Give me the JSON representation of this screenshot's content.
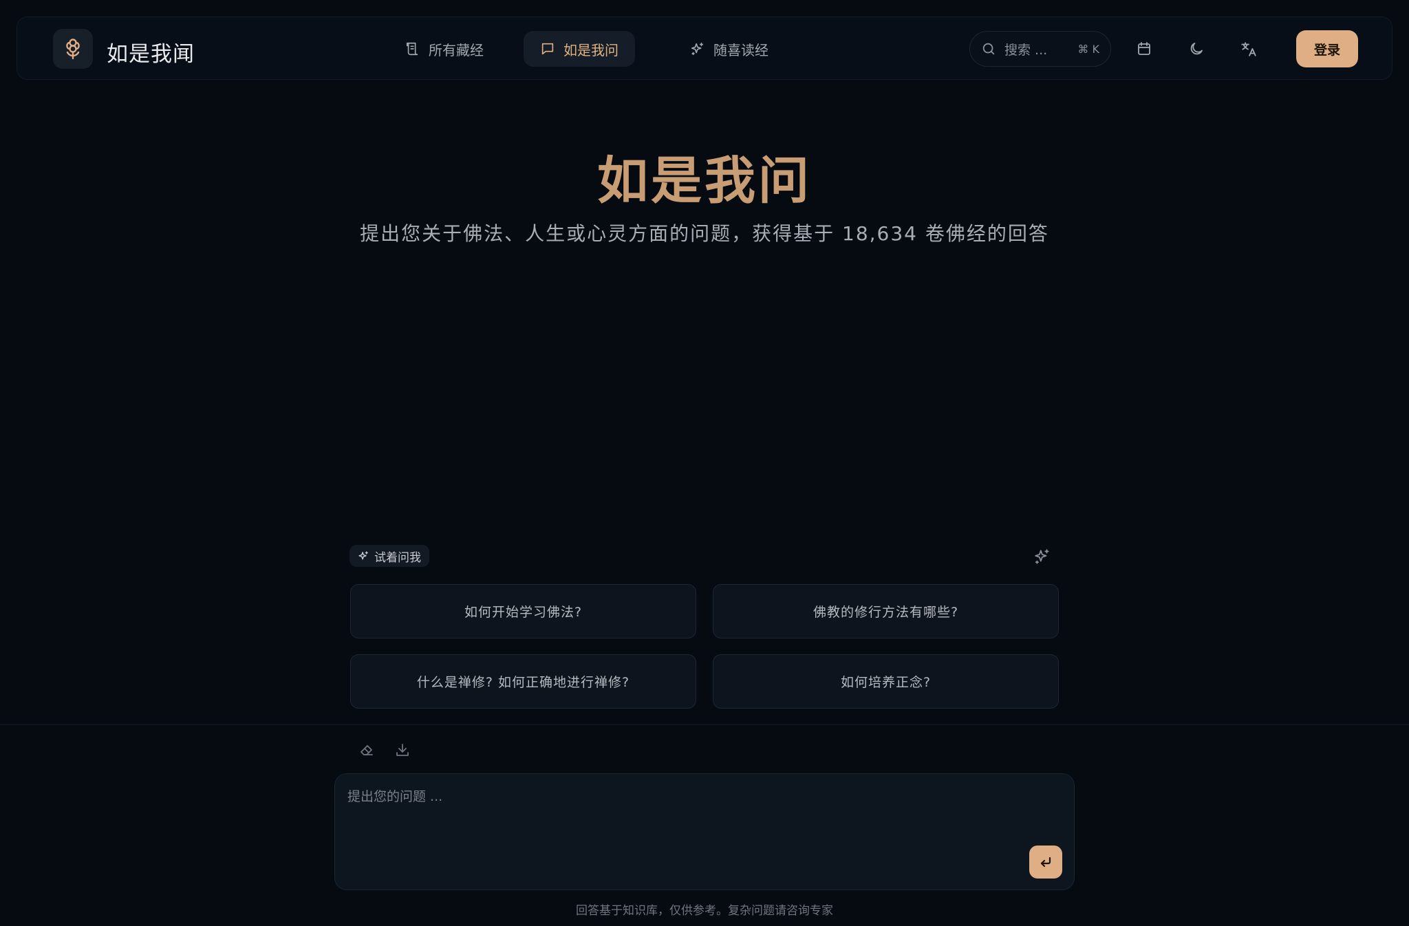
{
  "header": {
    "brand": "如是我闻",
    "nav": [
      {
        "label": "所有藏经",
        "icon": "scroll-icon",
        "active": false
      },
      {
        "label": "如是我问",
        "icon": "chat-icon",
        "active": true
      },
      {
        "label": "随喜读经",
        "icon": "sparkles-icon",
        "active": false
      }
    ],
    "search": {
      "placeholder": "搜索 ...",
      "shortcut": "⌘ K"
    },
    "actions": [
      "calendar-icon",
      "moon-icon",
      "translate-icon"
    ],
    "login_label": "登录"
  },
  "hero": {
    "title": "如是我问",
    "subtitle": "提出您关于佛法、人生或心灵方面的问题，获得基于 18,634 卷佛经的回答"
  },
  "suggestions": {
    "badge": "试着问我",
    "items": [
      "如何开始学习佛法?",
      "佛教的修行方法有哪些?",
      "什么是禅修? 如何正确地进行禅修?",
      "如何培养正念?"
    ]
  },
  "composer": {
    "placeholder": "提出您的问题 ..."
  },
  "footer": {
    "disclaimer": "回答基于知识库，仅供参考。复杂问题请咨询专家"
  },
  "colors": {
    "background": "#060a11",
    "accent": "#dfae84",
    "title": "#c99d74"
  }
}
